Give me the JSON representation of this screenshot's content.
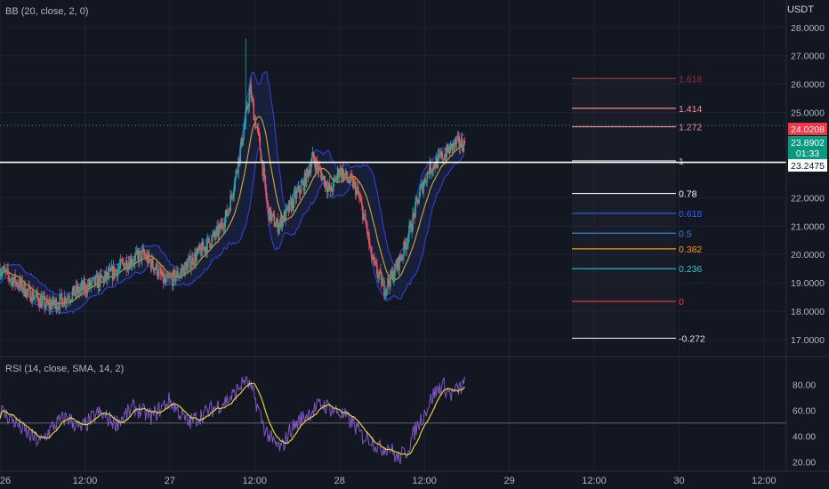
{
  "header": {
    "currency": "USDT"
  },
  "indicators": {
    "bb_label": "BB (20, close, 2, 0)",
    "rsi_label": "RSI (14, close, SMA, 14, 2)"
  },
  "colors": {
    "background": "#131722",
    "up": "#26a69a",
    "down": "#ef5350",
    "bb_band": "#2f3dc8",
    "bb_basis": "#c9a227",
    "bb_fill": "#1e2a5a",
    "rsi": "#7e57c2",
    "rsi_ma": "#e0d23c",
    "grid": "#1f2330",
    "hline": "#ffffff"
  },
  "price_badges": {
    "red_price": "24.0208",
    "green_price": "23.8902",
    "countdown": "01:33",
    "line_price": "23.2475"
  },
  "chart_data": [
    {
      "type": "candlestick",
      "title": "",
      "x_tick_labels": [
        "26",
        "12:00",
        "27",
        "12:00",
        "28",
        "12:00",
        "29",
        "12:00",
        "30",
        "12:00"
      ],
      "y_tick_labels": [
        "28.0000",
        "27.0000",
        "26.0000",
        "25.0000",
        "22.0000",
        "21.0000",
        "20.0000",
        "19.0000",
        "18.0000",
        "17.0000"
      ],
      "ylim": [
        16.5,
        28.4
      ],
      "price_path": {
        "t": [
          0,
          10,
          20,
          30,
          40,
          52,
          65,
          80,
          100,
          120,
          140,
          160,
          175,
          185,
          200,
          215,
          230,
          245,
          255,
          262,
          268,
          274,
          280,
          285,
          290,
          295,
          300,
          310,
          320,
          330,
          340,
          350,
          360,
          370,
          380,
          390,
          395,
          400,
          410,
          415,
          420,
          425,
          430,
          440,
          450,
          460,
          470,
          480,
          490,
          500,
          510,
          520
        ],
        "v": [
          19.5,
          19.2,
          19.0,
          18.7,
          18.5,
          18.2,
          18.3,
          18.6,
          18.9,
          19.2,
          19.7,
          20.0,
          19.5,
          19.0,
          19.3,
          19.8,
          20.3,
          20.8,
          21.5,
          22.5,
          23.5,
          24.6,
          25.8,
          24.8,
          24.0,
          22.8,
          21.5,
          21.0,
          21.4,
          22.0,
          22.5,
          23.4,
          22.8,
          22.2,
          23.0,
          22.6,
          22.5,
          22.2,
          21.0,
          20.0,
          19.5,
          19.2,
          18.8,
          19.3,
          20.0,
          21.0,
          22.2,
          23.0,
          23.3,
          23.6,
          23.9,
          23.89
        ]
      },
      "bollinger": {
        "period": 20,
        "multiplier": 2
      },
      "fibonacci": {
        "levels": [
          {
            "label": "1.618",
            "value": 26.2
          },
          {
            "label": "1.414",
            "value": 25.15
          },
          {
            "label": "1.272",
            "value": 24.5
          },
          {
            "label": "1",
            "value": 23.3
          },
          {
            "label": "0.78",
            "value": 22.15
          },
          {
            "label": "0.618",
            "value": 21.45
          },
          {
            "label": "0.5",
            "value": 20.75
          },
          {
            "label": "0.382",
            "value": 20.2
          },
          {
            "label": "0.236",
            "value": 19.5
          },
          {
            "label": "0",
            "value": 18.35
          },
          {
            "label": "-0.272",
            "value": 17.05
          }
        ],
        "colors": [
          "#9c2f3a",
          "#f28b9a",
          "#f28b9a",
          "#c0c0c0",
          "#ffffff",
          "#2962ff",
          "#3d7de0",
          "#ff9800",
          "#26c6da",
          "#f23645",
          "#e0e0e0"
        ]
      },
      "horizontal_line": 23.2475
    },
    {
      "type": "line",
      "title": "",
      "y_tick_labels": [
        "80.00",
        "60.00",
        "40.00",
        "20.00"
      ],
      "ylim": [
        14,
        90
      ],
      "midline": 50,
      "rsi_path": {
        "t": [
          0,
          15,
          30,
          45,
          60,
          75,
          90,
          110,
          130,
          150,
          170,
          190,
          210,
          230,
          250,
          262,
          275,
          285,
          295,
          305,
          315,
          325,
          340,
          360,
          380,
          395,
          405,
          415,
          425,
          435,
          445,
          455,
          465,
          475,
          485,
          495,
          505,
          520
        ],
        "v": [
          60,
          52,
          42,
          35,
          48,
          55,
          45,
          58,
          50,
          62,
          55,
          68,
          50,
          58,
          66,
          72,
          85,
          70,
          48,
          35,
          30,
          45,
          55,
          65,
          58,
          50,
          40,
          38,
          30,
          32,
          22,
          28,
          45,
          58,
          72,
          80,
          72,
          80
        ]
      }
    }
  ]
}
